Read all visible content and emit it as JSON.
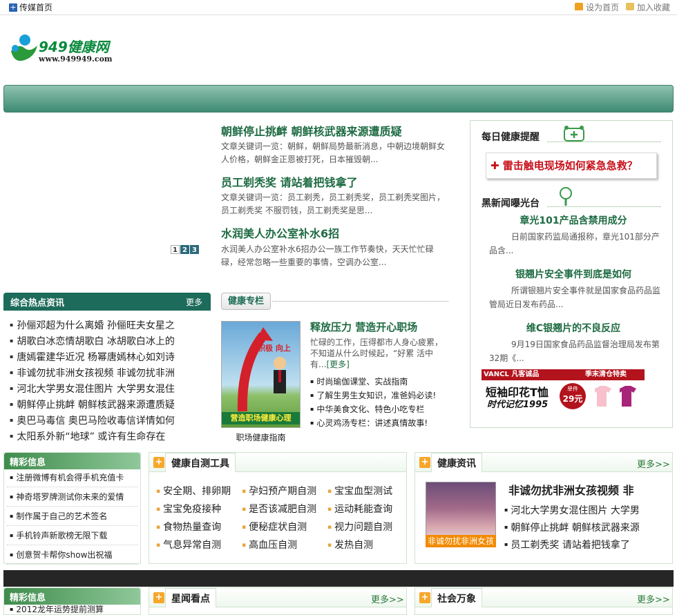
{
  "topbar": {
    "home_label": "传媒首页",
    "set_home": "设为首页",
    "add_fav": "加入收藏"
  },
  "logo": {
    "name": "949健康网",
    "url": "www.949949.com"
  },
  "slider": {
    "pages": [
      "1",
      "2",
      "3"
    ],
    "active": "1"
  },
  "headlines": [
    {
      "title": "朝鲜停止挑衅 朝鲜核武器来源遭质疑",
      "desc": "文章关键词一览：朝鲜，朝鲜局势最新消息，中朝边境朝鲜女人价格，朝鲜金正恩被打死，日本摧毁朝..."
    },
    {
      "title": "员工剃秃奖 请站着把钱拿了",
      "desc": "文章关键词一览：员工剃秃，员工剃秃奖，员工剃秃奖图片，员工剃秃奖 不服罚钱，员工剃秃奖是思..."
    },
    {
      "title": "水润美人办公室补水6招",
      "desc": "水润美人办公室补水6招办公一族工作节奏快，天天忙忙碌碌，经常忽略一些重要的事情，空调办公室..."
    }
  ],
  "right_panel": {
    "daily_head": "每日健康提醒",
    "rescue_text": "雷击触电现场如何紧急急救？",
    "black_head": "黑新闻曝光台",
    "items": [
      {
        "title": "章光101产品含禁用成分",
        "desc": "日前国家药监局通报称，章光101部分产品含..."
      },
      {
        "title": "银翘片安全事件到底是如何",
        "desc": "所谓银翘片安全事件就是国家食品药品监管局近日发布药品..."
      },
      {
        "title": "维C银翘片的不良反应",
        "desc": "9月19日国家食品药品监督治理局发布第32期《..."
      }
    ],
    "ad": {
      "brand": "VANCL 凡客诚品",
      "banner": "季末清仓特卖",
      "slogan": "短袖印花T恤",
      "sub": "时代记忆1995",
      "price_label": "单件",
      "price": "29元"
    }
  },
  "hot": {
    "title": "综合热点资讯",
    "more": "更多",
    "items": [
      "孙俪邓超为什么离婚 孙俪旺夫女星之",
      "胡歌白冰恋情胡歌白 冰胡歌白冰上的",
      "唐嫣霍建华近况 杨幂唐嫣林心如刘诗",
      "非诚勿扰非洲女孩视频 非诚勿扰非洲",
      "河北大学男女混住图片 大学男女混住",
      "朝鲜停止挑衅 朝鲜核武器来源遭质疑",
      "奥巴马毒信 奥巴马险收毒信详情如何",
      "太阳系外新“地球” 或许有生命存在"
    ]
  },
  "health_column": {
    "tab": "健康专栏",
    "image_text_1": "积极 向上",
    "image_caption_banner": "营造职场健康心理",
    "caption": "职场健康指南",
    "head": "释放压力 营造开心职场",
    "desc": "忙碌的工作，压得都市人身心疲累，不知道从什么时候起，“好累 活中有...",
    "more": "[更多]",
    "list": [
      "时尚瑜伽课堂、实战指南",
      "了解生男生女知识，准爸妈必读!",
      "中华美食文化、特色小吃专栏",
      "心灵鸡汤专栏：讲述真情故事!"
    ]
  },
  "jingcai_1": {
    "title": "精彩信息",
    "items": [
      "注册微博有机会得手机充值卡",
      "神奇塔罗牌测试你未来的爱情",
      "制作属于自己的艺术签名",
      "手机铃声新歌榜无限下载",
      "创意贺卡帮你show出祝福"
    ]
  },
  "tools": {
    "title": "健康自测工具",
    "items": [
      "安全期、排卵期",
      "孕妇预产期自测",
      "宝宝血型测试",
      "宝宝免疫接种",
      "是否该减肥自测",
      "运动耗能查询",
      "食物热量查询",
      "便秘症状自测",
      "视力问题自测",
      "气息异常自测",
      "高血压自测",
      "发热自测"
    ]
  },
  "health_info": {
    "title": "健康资讯",
    "more": "更多>>",
    "image_caption": "非诚勿扰非洲女孩",
    "head": "非诚勿扰非洲女孩视频 非",
    "list": [
      "河北大学男女混住图片 大学男",
      "朝鲜停止挑衅 朝鲜核武器来源",
      "员工剃秃奖 请站着把钱拿了"
    ]
  },
  "jingcai_2": {
    "title": "精彩信息",
    "items": [
      "2012龙年运势提前测算"
    ]
  },
  "star": {
    "title": "星闻看点",
    "more": "更多>>"
  },
  "society": {
    "title": "社会万象",
    "more": "更多>>"
  }
}
